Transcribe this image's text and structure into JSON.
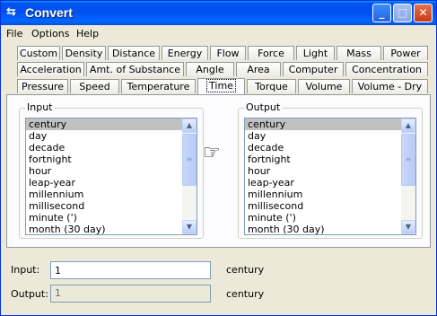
{
  "window": {
    "title": "Convert",
    "icon": "arrows-icon"
  },
  "menu": [
    {
      "label": "File",
      "mnemonic": "F"
    },
    {
      "label": "Options",
      "mnemonic": "O"
    },
    {
      "label": "Help",
      "mnemonic": "H"
    }
  ],
  "tabs": {
    "row1": [
      "Custom",
      "Density",
      "Distance",
      "Energy",
      "Flow",
      "Force",
      "Light",
      "Mass",
      "Power"
    ],
    "row2": [
      "Acceleration",
      "Amt. of Substance",
      "Angle",
      "Area",
      "Computer",
      "Concentration"
    ],
    "row3": [
      "Pressure",
      "Speed",
      "Temperature",
      "Time",
      "Torque",
      "Volume",
      "Volume - Dry"
    ],
    "selected": "Time"
  },
  "input_group": {
    "label": "Input",
    "items": [
      "century",
      "day",
      "decade",
      "fortnight",
      "hour",
      "leap-year",
      "millennium",
      "millisecond",
      "minute (')",
      "month (30 day)"
    ],
    "selected": "century"
  },
  "output_group": {
    "label": "Output",
    "items": [
      "century",
      "day",
      "decade",
      "fortnight",
      "hour",
      "leap-year",
      "millennium",
      "millisecond",
      "minute (')",
      "month (30 day)"
    ],
    "selected": "century"
  },
  "fields": {
    "input_label": "Input:",
    "input_value": "1",
    "input_unit": "century",
    "output_label": "Output:",
    "output_value": "1",
    "output_unit": "century"
  },
  "pointer_icon": "hand-pointer-icon"
}
